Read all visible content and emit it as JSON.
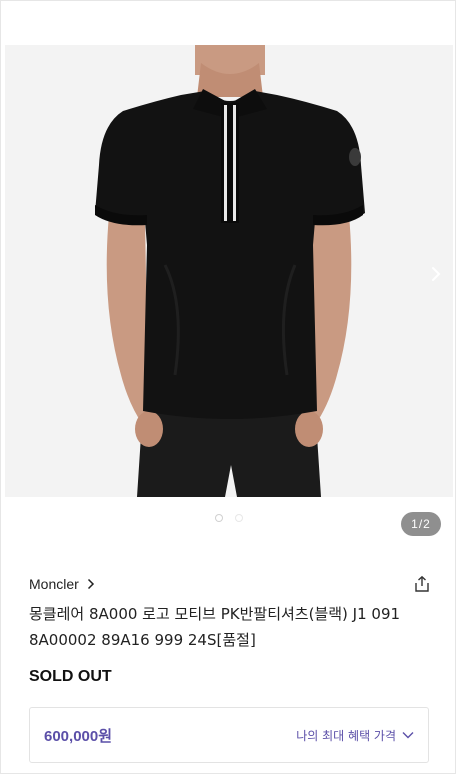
{
  "gallery": {
    "image_alt": "Moncler black polo shirt product photo",
    "next_icon": "chevron-right-icon",
    "current_index": 1,
    "total": 2,
    "counter_text": "1/2"
  },
  "product": {
    "brand": "Moncler",
    "brand_icon": "chevron-right-icon",
    "share_icon": "share-icon",
    "title": "몽클레어 8A000 로고 모티브 PK반팔티셔츠(블랙) J1 091 8A00002 89A16 999 24S[품절]",
    "status": "SOLD OUT"
  },
  "pricing": {
    "price": "600,000원",
    "benefit_label": "나의 최대 혜택 가격",
    "benefit_icon": "chevron-down-icon",
    "accent_color": "#5b4fa8"
  }
}
